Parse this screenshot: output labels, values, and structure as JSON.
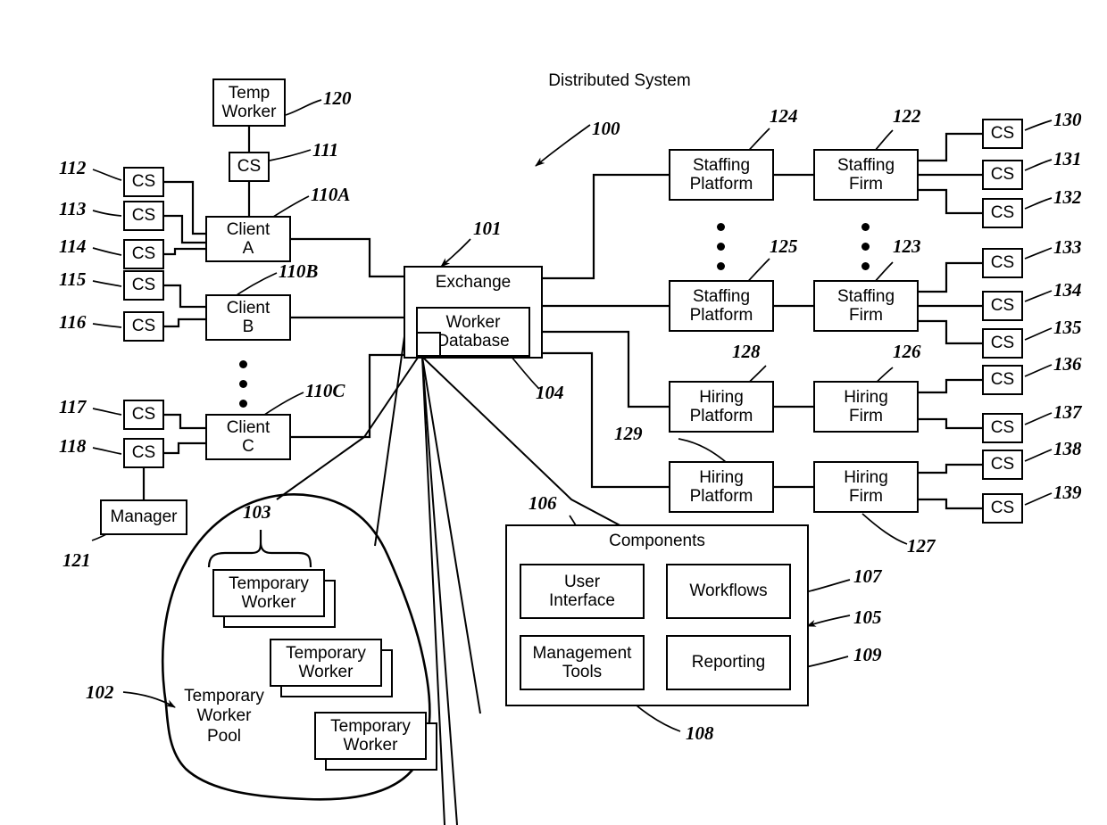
{
  "figure": {
    "title_label": "Distributed System",
    "title_ref": "100"
  },
  "nodes": {
    "temp_worker": {
      "label": "Temp\nWorker",
      "ref": "120"
    },
    "temp_worker_cs": {
      "label": "CS",
      "ref": "111"
    },
    "client_a": {
      "label": "Client\nA",
      "ref": "110A"
    },
    "client_b": {
      "label": "Client\nB",
      "ref": "110B"
    },
    "client_c": {
      "label": "Client\nC",
      "ref": "110C"
    },
    "manager": {
      "label": "Manager",
      "ref": "121"
    },
    "exchange": {
      "label": "Exchange",
      "ref": "101"
    },
    "worker_database": {
      "label": "Worker\nDatabase",
      "ref": "104"
    },
    "components": {
      "label": "Components",
      "ref": "105"
    },
    "user_interface": {
      "label": "User\nInterface",
      "ref": "106"
    },
    "workflows": {
      "label": "Workflows",
      "ref": "107"
    },
    "management_tools": {
      "label": "Management\nTools",
      "ref": "108"
    },
    "reporting": {
      "label": "Reporting",
      "ref": "109"
    },
    "temporary_worker_pool": {
      "label": "Temporary\nWorker\nPool",
      "ref": "102"
    },
    "temporary_workers_group": {
      "ref": "103"
    },
    "temporary_worker_1": {
      "label": "Temporary\nWorker"
    },
    "temporary_worker_2": {
      "label": "Temporary\nWorker"
    },
    "temporary_worker_3": {
      "label": "Temporary\nWorker"
    },
    "staffing_platform_1": {
      "label": "Staffing\nPlatform",
      "ref": "124"
    },
    "staffing_platform_2": {
      "label": "Staffing\nPlatform",
      "ref": "125"
    },
    "staffing_firm_1": {
      "label": "Staffing\nFirm",
      "ref": "122"
    },
    "staffing_firm_2": {
      "label": "Staffing\nFirm",
      "ref": "123"
    },
    "hiring_platform_1": {
      "label": "Hiring\nPlatform",
      "ref": "128"
    },
    "hiring_platform_2": {
      "label": "Hiring\nPlatform",
      "ref": "129"
    },
    "hiring_firm_1": {
      "label": "Hiring\nFirm",
      "ref": "126"
    },
    "hiring_firm_2": {
      "label": "Hiring\nFirm",
      "ref": "127"
    }
  },
  "client_terminals": [
    {
      "label": "CS",
      "ref": "112"
    },
    {
      "label": "CS",
      "ref": "113"
    },
    {
      "label": "CS",
      "ref": "114"
    },
    {
      "label": "CS",
      "ref": "115"
    },
    {
      "label": "CS",
      "ref": "116"
    },
    {
      "label": "CS",
      "ref": "117"
    },
    {
      "label": "CS",
      "ref": "118"
    }
  ],
  "firm_terminals": [
    {
      "label": "CS",
      "ref": "130"
    },
    {
      "label": "CS",
      "ref": "131"
    },
    {
      "label": "CS",
      "ref": "132"
    },
    {
      "label": "CS",
      "ref": "133"
    },
    {
      "label": "CS",
      "ref": "134"
    },
    {
      "label": "CS",
      "ref": "135"
    },
    {
      "label": "CS",
      "ref": "136"
    },
    {
      "label": "CS",
      "ref": "137"
    },
    {
      "label": "CS",
      "ref": "138"
    },
    {
      "label": "CS",
      "ref": "139"
    }
  ],
  "colors": {
    "line": "#000000",
    "background": "#ffffff"
  }
}
